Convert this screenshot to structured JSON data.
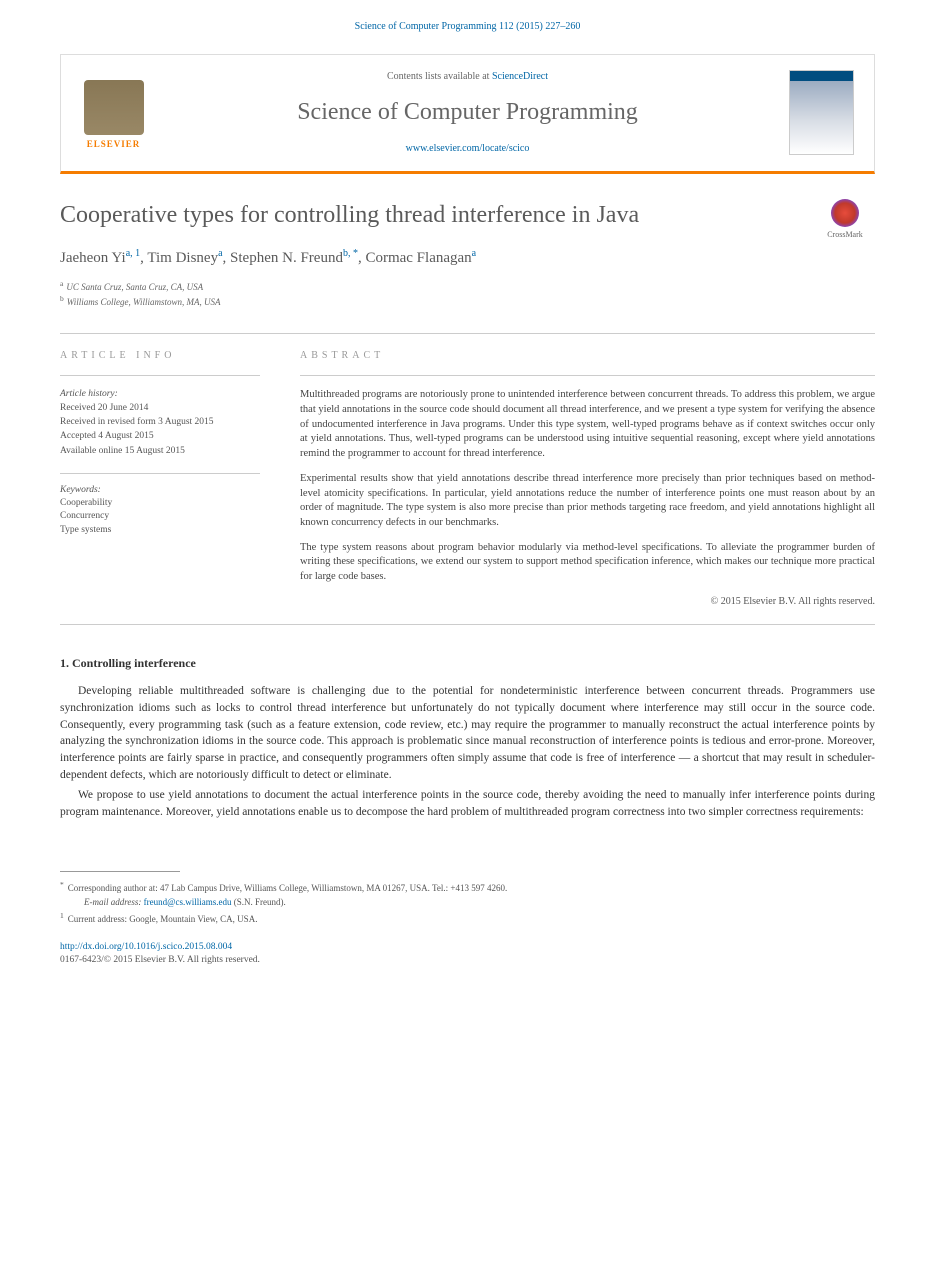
{
  "citation": "Science of Computer Programming 112 (2015) 227–260",
  "header": {
    "contentsPrefix": "Contents lists available at ",
    "contentsLink": "ScienceDirect",
    "journalTitle": "Science of Computer Programming",
    "journalUrl": "www.elsevier.com/locate/scico",
    "publisherName": "ELSEVIER"
  },
  "crossmark": "CrossMark",
  "article": {
    "title": "Cooperative types for controlling thread interference in Java",
    "authors": [
      {
        "name": "Jaeheon Yi",
        "marks": "a, 1"
      },
      {
        "name": "Tim Disney",
        "marks": "a"
      },
      {
        "name": "Stephen N. Freund",
        "marks": "b, *"
      },
      {
        "name": "Cormac Flanagan",
        "marks": "a"
      }
    ],
    "affiliations": [
      {
        "mark": "a",
        "text": "UC Santa Cruz, Santa Cruz, CA, USA"
      },
      {
        "mark": "b",
        "text": "Williams College, Williamstown, MA, USA"
      }
    ]
  },
  "info": {
    "header": "ARTICLE INFO",
    "historyLabel": "Article history:",
    "history": [
      "Received 20 June 2014",
      "Received in revised form 3 August 2015",
      "Accepted 4 August 2015",
      "Available online 15 August 2015"
    ],
    "keywordsLabel": "Keywords:",
    "keywords": [
      "Cooperability",
      "Concurrency",
      "Type systems"
    ]
  },
  "abstract": {
    "header": "ABSTRACT",
    "paragraphs": [
      "Multithreaded programs are notoriously prone to unintended interference between concurrent threads. To address this problem, we argue that yield annotations in the source code should document all thread interference, and we present a type system for verifying the absence of undocumented interference in Java programs. Under this type system, well-typed programs behave as if context switches occur only at yield annotations. Thus, well-typed programs can be understood using intuitive sequential reasoning, except where yield annotations remind the programmer to account for thread interference.",
      "Experimental results show that yield annotations describe thread interference more precisely than prior techniques based on method-level atomicity specifications. In particular, yield annotations reduce the number of interference points one must reason about by an order of magnitude. The type system is also more precise than prior methods targeting race freedom, and yield annotations highlight all known concurrency defects in our benchmarks.",
      "The type system reasons about program behavior modularly via method-level specifications. To alleviate the programmer burden of writing these specifications, we extend our system to support method specification inference, which makes our technique more practical for large code bases."
    ],
    "copyright": "© 2015 Elsevier B.V. All rights reserved."
  },
  "body": {
    "sectionTitle": "1. Controlling interference",
    "paragraphs": [
      "Developing reliable multithreaded software is challenging due to the potential for nondeterministic interference between concurrent threads. Programmers use synchronization idioms such as locks to control thread interference but unfortunately do not typically document where interference may still occur in the source code. Consequently, every programming task (such as a feature extension, code review, etc.) may require the programmer to manually reconstruct the actual interference points by analyzing the synchronization idioms in the source code. This approach is problematic since manual reconstruction of interference points is tedious and error-prone. Moreover, interference points are fairly sparse in practice, and consequently programmers often simply assume that code is free of interference — a shortcut that may result in scheduler-dependent defects, which are notoriously difficult to detect or eliminate.",
      "We propose to use yield annotations to document the actual interference points in the source code, thereby avoiding the need to manually infer interference points during program maintenance. Moreover, yield annotations enable us to decompose the hard problem of multithreaded program correctness into two simpler correctness requirements:"
    ]
  },
  "footnotes": {
    "corresponding": "Corresponding author at: 47 Lab Campus Drive, Williams College, Williamstown, MA 01267, USA. Tel.: +413 597 4260.",
    "emailLabel": "E-mail address: ",
    "email": "freund@cs.williams.edu",
    "emailSuffix": " (S.N. Freund).",
    "current": "Current address: Google, Mountain View, CA, USA."
  },
  "footer": {
    "doi": "http://dx.doi.org/10.1016/j.scico.2015.08.004",
    "copyright": "0167-6423/© 2015 Elsevier B.V. All rights reserved."
  }
}
